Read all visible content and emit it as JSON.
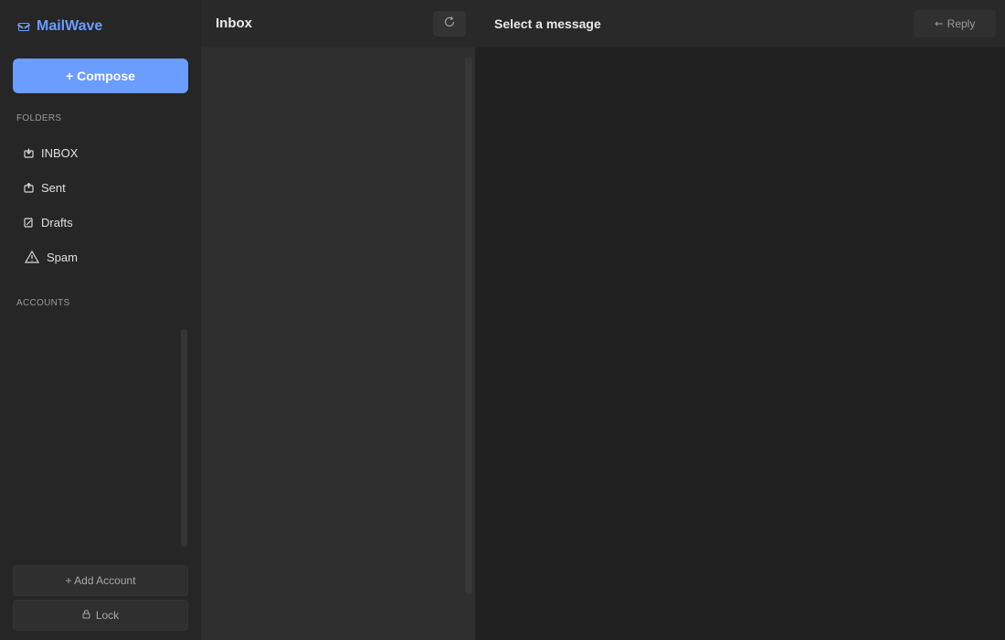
{
  "app": {
    "name": "MailWave",
    "accent": "#6b9cff"
  },
  "sidebar": {
    "compose_label": "+ Compose",
    "folders_heading": "FOLDERS",
    "folders": [
      {
        "label": "INBOX",
        "icon": "inbox-icon"
      },
      {
        "label": "Sent",
        "icon": "outbox-icon"
      },
      {
        "label": "Drafts",
        "icon": "draft-icon"
      },
      {
        "label": "Spam",
        "icon": "warning-icon"
      }
    ],
    "accounts_heading": "ACCOUNTS",
    "add_account_label": "+ Add Account",
    "lock_label": "Lock"
  },
  "list": {
    "title": "Inbox",
    "refresh_icon": "refresh-icon"
  },
  "reader": {
    "title": "Select a message",
    "reply_label": "Reply",
    "reply_icon": "reply-arrow-icon"
  }
}
